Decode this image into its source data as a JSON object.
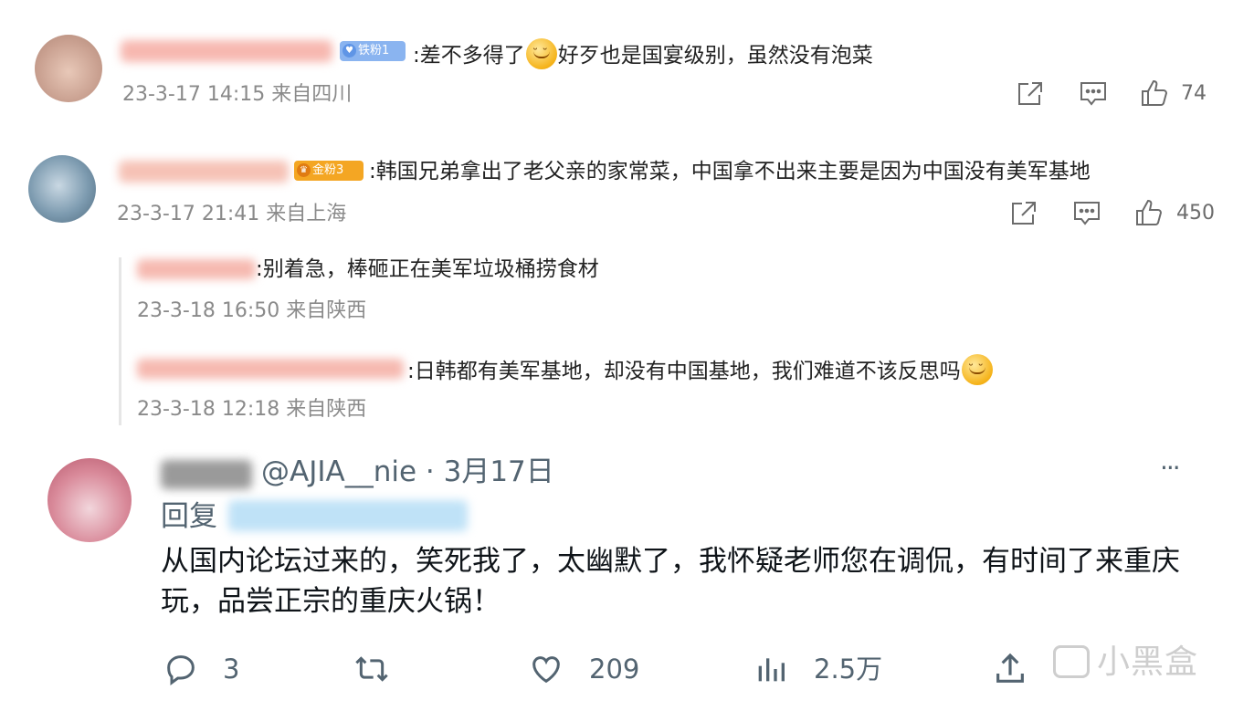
{
  "weibo": {
    "comments": [
      {
        "badge": "铁粉1",
        "text_a": ":差不多得了",
        "text_b": "好歹也是国宴级别，虽然没有泡菜",
        "time": "23-3-17 14:15 来自四川",
        "likes": "74"
      },
      {
        "badge": "金粉3",
        "text": ":韩国兄弟拿出了老父亲的家常菜，中国拿不出来主要是因为中国没有美军基地",
        "time": "23-3-17 21:41 来自上海",
        "likes": "450"
      }
    ],
    "replies": [
      {
        "text": ":别着急，棒砸正在美军垃圾桶捞食材",
        "time": "23-3-18 16:50 来自陕西"
      },
      {
        "text": ":日韩都有美军基地，却没有中国基地，我们难道不该反思吗",
        "time": "23-3-18 12:18 来自陕西"
      }
    ]
  },
  "tweet": {
    "handle_date": "@AJIA__nie · 3月17日",
    "reply_prefix": "回复",
    "text": "从国内论坛过来的，笑死我了，太幽默了，我怀疑老师您在调侃，有时间了来重庆玩，品尝正宗的重庆火锅！",
    "more": "···",
    "replies": "3",
    "likes": "209",
    "views": "2.5万"
  },
  "watermark": "小黑盒",
  "colors": {
    "badge_iron": "#8ab4f0",
    "badge_gold": "#f4a623",
    "meta_gray": "#8a8a8a",
    "tweet_gray": "#536471"
  },
  "icons": [
    "share-icon",
    "comment-icon",
    "like-icon",
    "reply-icon",
    "retweet-icon",
    "heart-icon",
    "views-icon",
    "upload-icon"
  ]
}
